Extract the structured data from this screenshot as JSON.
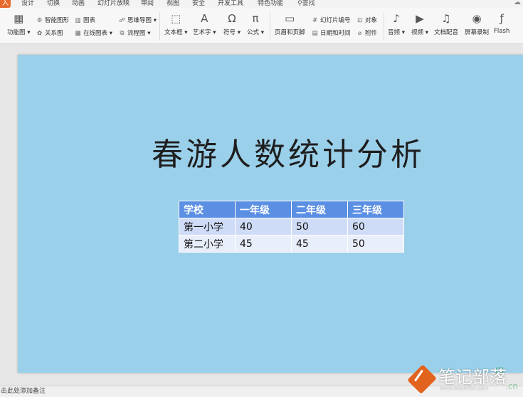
{
  "menu": {
    "tabs": [
      "入",
      "设计",
      "切换",
      "动画",
      "幻灯片放映",
      "审阅",
      "视图",
      "安全",
      "开发工具",
      "特色功能"
    ],
    "active_index": 0,
    "search": "查找"
  },
  "ribbon": {
    "func_chart": "功能图",
    "smart_shape": "智能图形",
    "chart": "图表",
    "relation_chart": "关系图",
    "online_chart": "在线图表",
    "mind_map": "思维导图",
    "flow_chart": "流程图",
    "textbox": "文本框",
    "wordart": "艺术字",
    "symbol": "符号",
    "formula": "公式",
    "header_footer": "页眉和页脚",
    "slide_number": "幻灯片编号",
    "object": "对象",
    "date_time": "日期和时间",
    "attachment": "附件",
    "audio": "音频",
    "video": "视频",
    "voiceover": "文档配音",
    "screen_record": "屏幕录制",
    "flash": "Flash"
  },
  "slide": {
    "title": "春游人数统计分析",
    "table": {
      "headers": [
        "学校",
        "一年级",
        "二年级",
        "三年级"
      ],
      "rows": [
        [
          "第一小学",
          "40",
          "50",
          "60"
        ],
        [
          "第二小学",
          "45",
          "45",
          "50"
        ]
      ]
    }
  },
  "notes": {
    "placeholder": "击此处添加备注"
  },
  "watermark": {
    "name": "笔记部落",
    "url": "www.notetribe.com",
    "faint": "网",
    "faint2": ".cn"
  },
  "colors": {
    "slide_bg": "#9bd0ea",
    "table_header": "#5b8fe3",
    "table_row1": "#cfdcf7",
    "table_row2": "#e9eefb",
    "accent_tab": "#e8692c",
    "watermark_logo": "#e2631e"
  }
}
